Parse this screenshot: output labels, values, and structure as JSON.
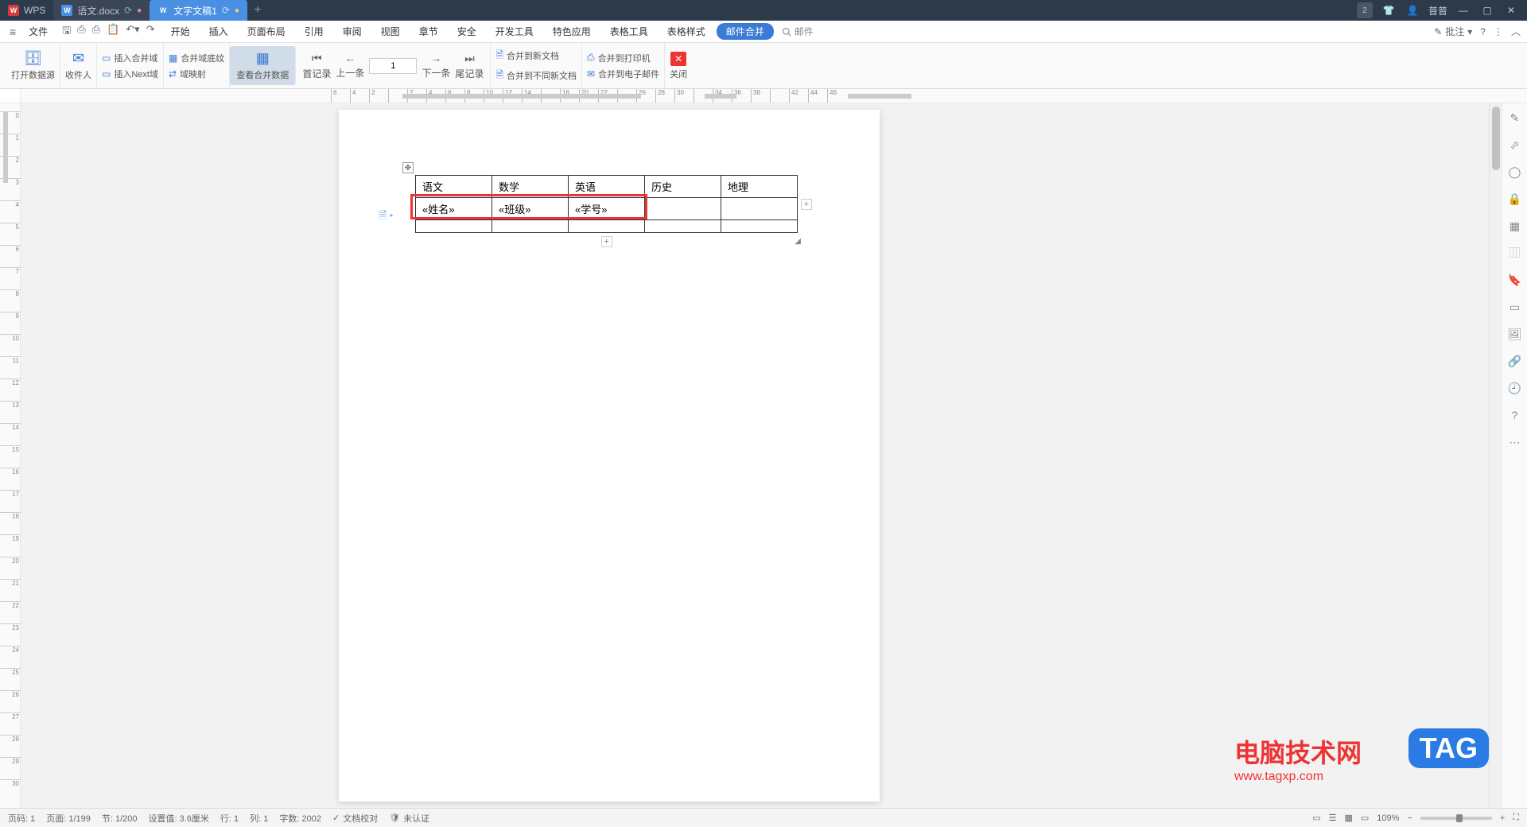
{
  "titlebar": {
    "app": "WPS",
    "tabs": [
      {
        "icon": "W",
        "label": "语文.docx"
      },
      {
        "icon": "W",
        "label": "文字文稿1"
      }
    ],
    "notif_badge": "2",
    "user": "普普"
  },
  "menubar": {
    "file": "文件",
    "tabs": [
      "开始",
      "插入",
      "页面布局",
      "引用",
      "审阅",
      "视图",
      "章节",
      "安全",
      "开发工具",
      "特色应用",
      "表格工具",
      "表格样式",
      "邮件合并"
    ],
    "active_tab": "邮件合并",
    "search_placeholder": "邮件",
    "comment_label": "批注"
  },
  "ribbon": {
    "open_data": "打开数据源",
    "recipients": "收件人",
    "insert_field": "插入合并域",
    "merge_field_shade": "合并域底纹",
    "insert_next": "插入Next域",
    "field_map": "域映射",
    "view_merge": "查看合并数据",
    "first": "首记录",
    "prev": "上一条",
    "record_num": "1",
    "next": "下一条",
    "last": "尾记录",
    "merge_new": "合并到新文档",
    "merge_diff": "合并到不同新文档",
    "merge_print": "合并到打印机",
    "merge_email": "合并到电子邮件",
    "close": "关闭"
  },
  "document": {
    "table": {
      "headers": [
        "语文",
        "数学",
        "英语",
        "历史",
        "地理"
      ],
      "row2": [
        "«姓名»",
        "«班级»",
        "«学号»",
        "",
        ""
      ]
    }
  },
  "statusbar": {
    "page_no": "页码: 1",
    "page_of": "页面: 1/199",
    "section": "节: 1/200",
    "pos": "设置值: 3.6厘米",
    "line": "行: 1",
    "col": "列: 1",
    "words": "字数: 2002",
    "proof": "文档校对",
    "auth": "未认证",
    "zoom": "109%"
  },
  "ruler": {
    "hticks": [
      "6",
      "4",
      "2",
      "",
      "2",
      "4",
      "6",
      "8",
      "10",
      "12",
      "14",
      "",
      "18",
      "20",
      "22",
      "",
      "26",
      "28",
      "30",
      "",
      "34",
      "36",
      "38",
      "",
      "42",
      "44",
      "46"
    ]
  },
  "watermark": {
    "title": "电脑技术网",
    "url": "www.tagxp.com",
    "tag": "TAG"
  }
}
